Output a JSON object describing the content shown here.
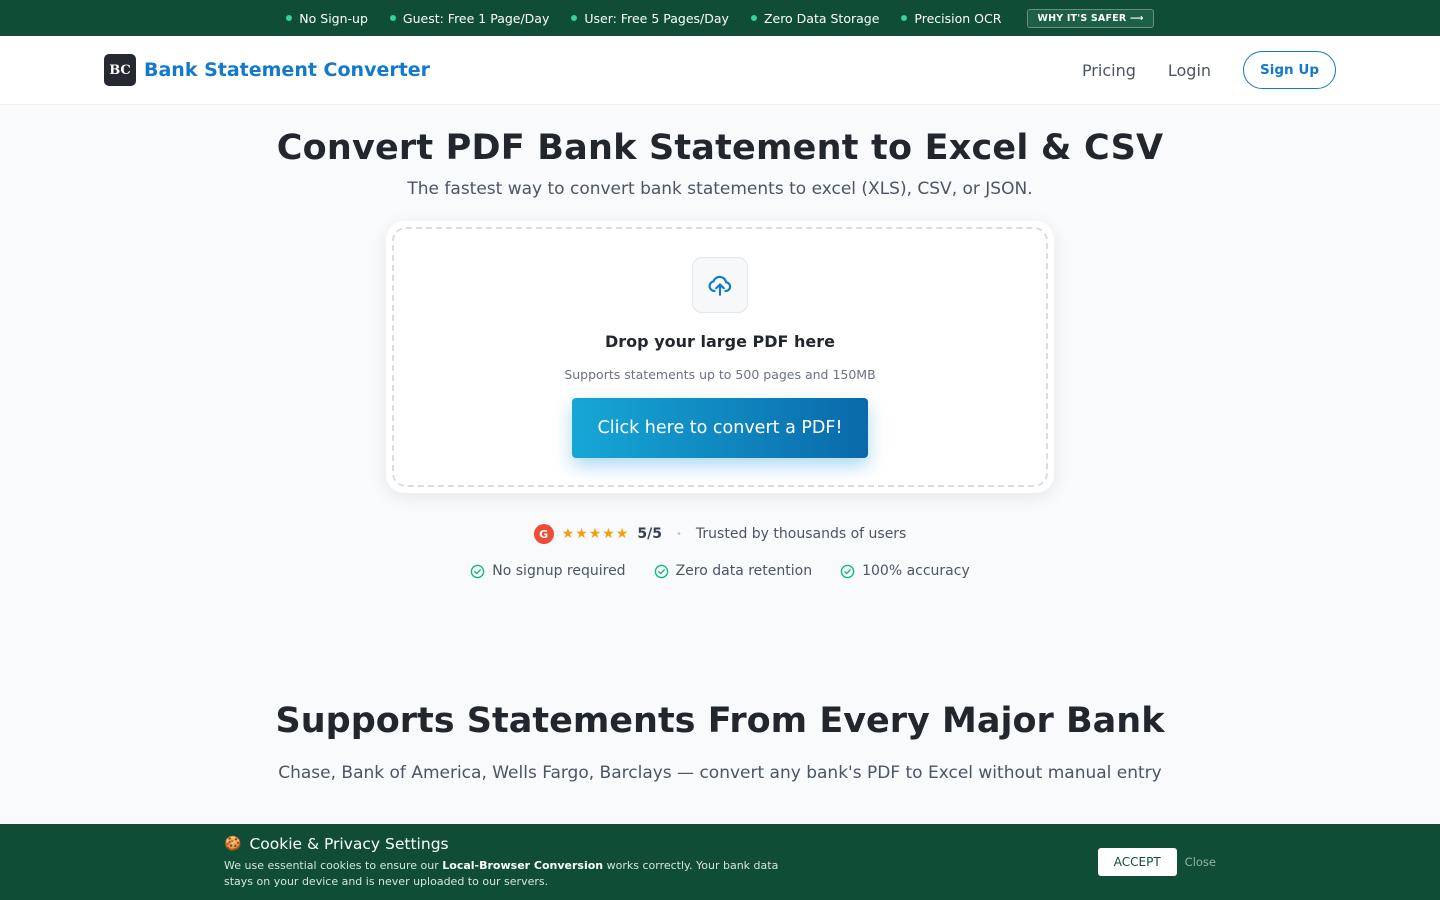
{
  "topbar": {
    "features": [
      "No Sign-up",
      "Guest: Free 1 Page/Day",
      "User: Free 5 Pages/Day",
      "Zero Data Storage",
      "Precision OCR"
    ],
    "why_label": "WHY IT'S SAFER ⟶"
  },
  "nav": {
    "logo_text": "BC",
    "brand_name": "Bank Statement Converter",
    "pricing": "Pricing",
    "login": "Login",
    "signup": "Sign Up"
  },
  "hero": {
    "title": "Convert PDF Bank Statement to Excel & CSV",
    "subtitle": "The fastest way to convert bank statements to excel (XLS), CSV, or JSON."
  },
  "dropzone": {
    "title": "Drop your large PDF here",
    "note": "Supports statements up to 500 pages and 150MB",
    "button": "Click here to convert a PDF!"
  },
  "rating": {
    "badge": "G",
    "stars": "★★★★★",
    "score": "5/5",
    "separator": "•",
    "trusted": "Trusted by thousands of users"
  },
  "checks": [
    "No signup required",
    "Zero data retention",
    "100% accuracy"
  ],
  "banks_section": {
    "title": "Supports Statements From Every Major Bank",
    "subtitle": "Chase, Bank of America, Wells Fargo, Barclays — convert any bank's PDF to Excel without manual entry"
  },
  "cookie": {
    "icon": "🍪",
    "title": "Cookie & Privacy Settings",
    "desc_before": "We use essential cookies to ensure our ",
    "desc_bold": "Local-Browser Conversion",
    "desc_after": " works correctly. Your bank data stays on your device and is never uploaded to our servers.",
    "accept": "ACCEPT",
    "close": "Close"
  },
  "colors": {
    "topbar_bg": "#0f4d36",
    "brand_blue": "#1479c9",
    "accent_green": "#34d399",
    "check_green": "#10b981",
    "star_gold": "#f59e0b"
  }
}
